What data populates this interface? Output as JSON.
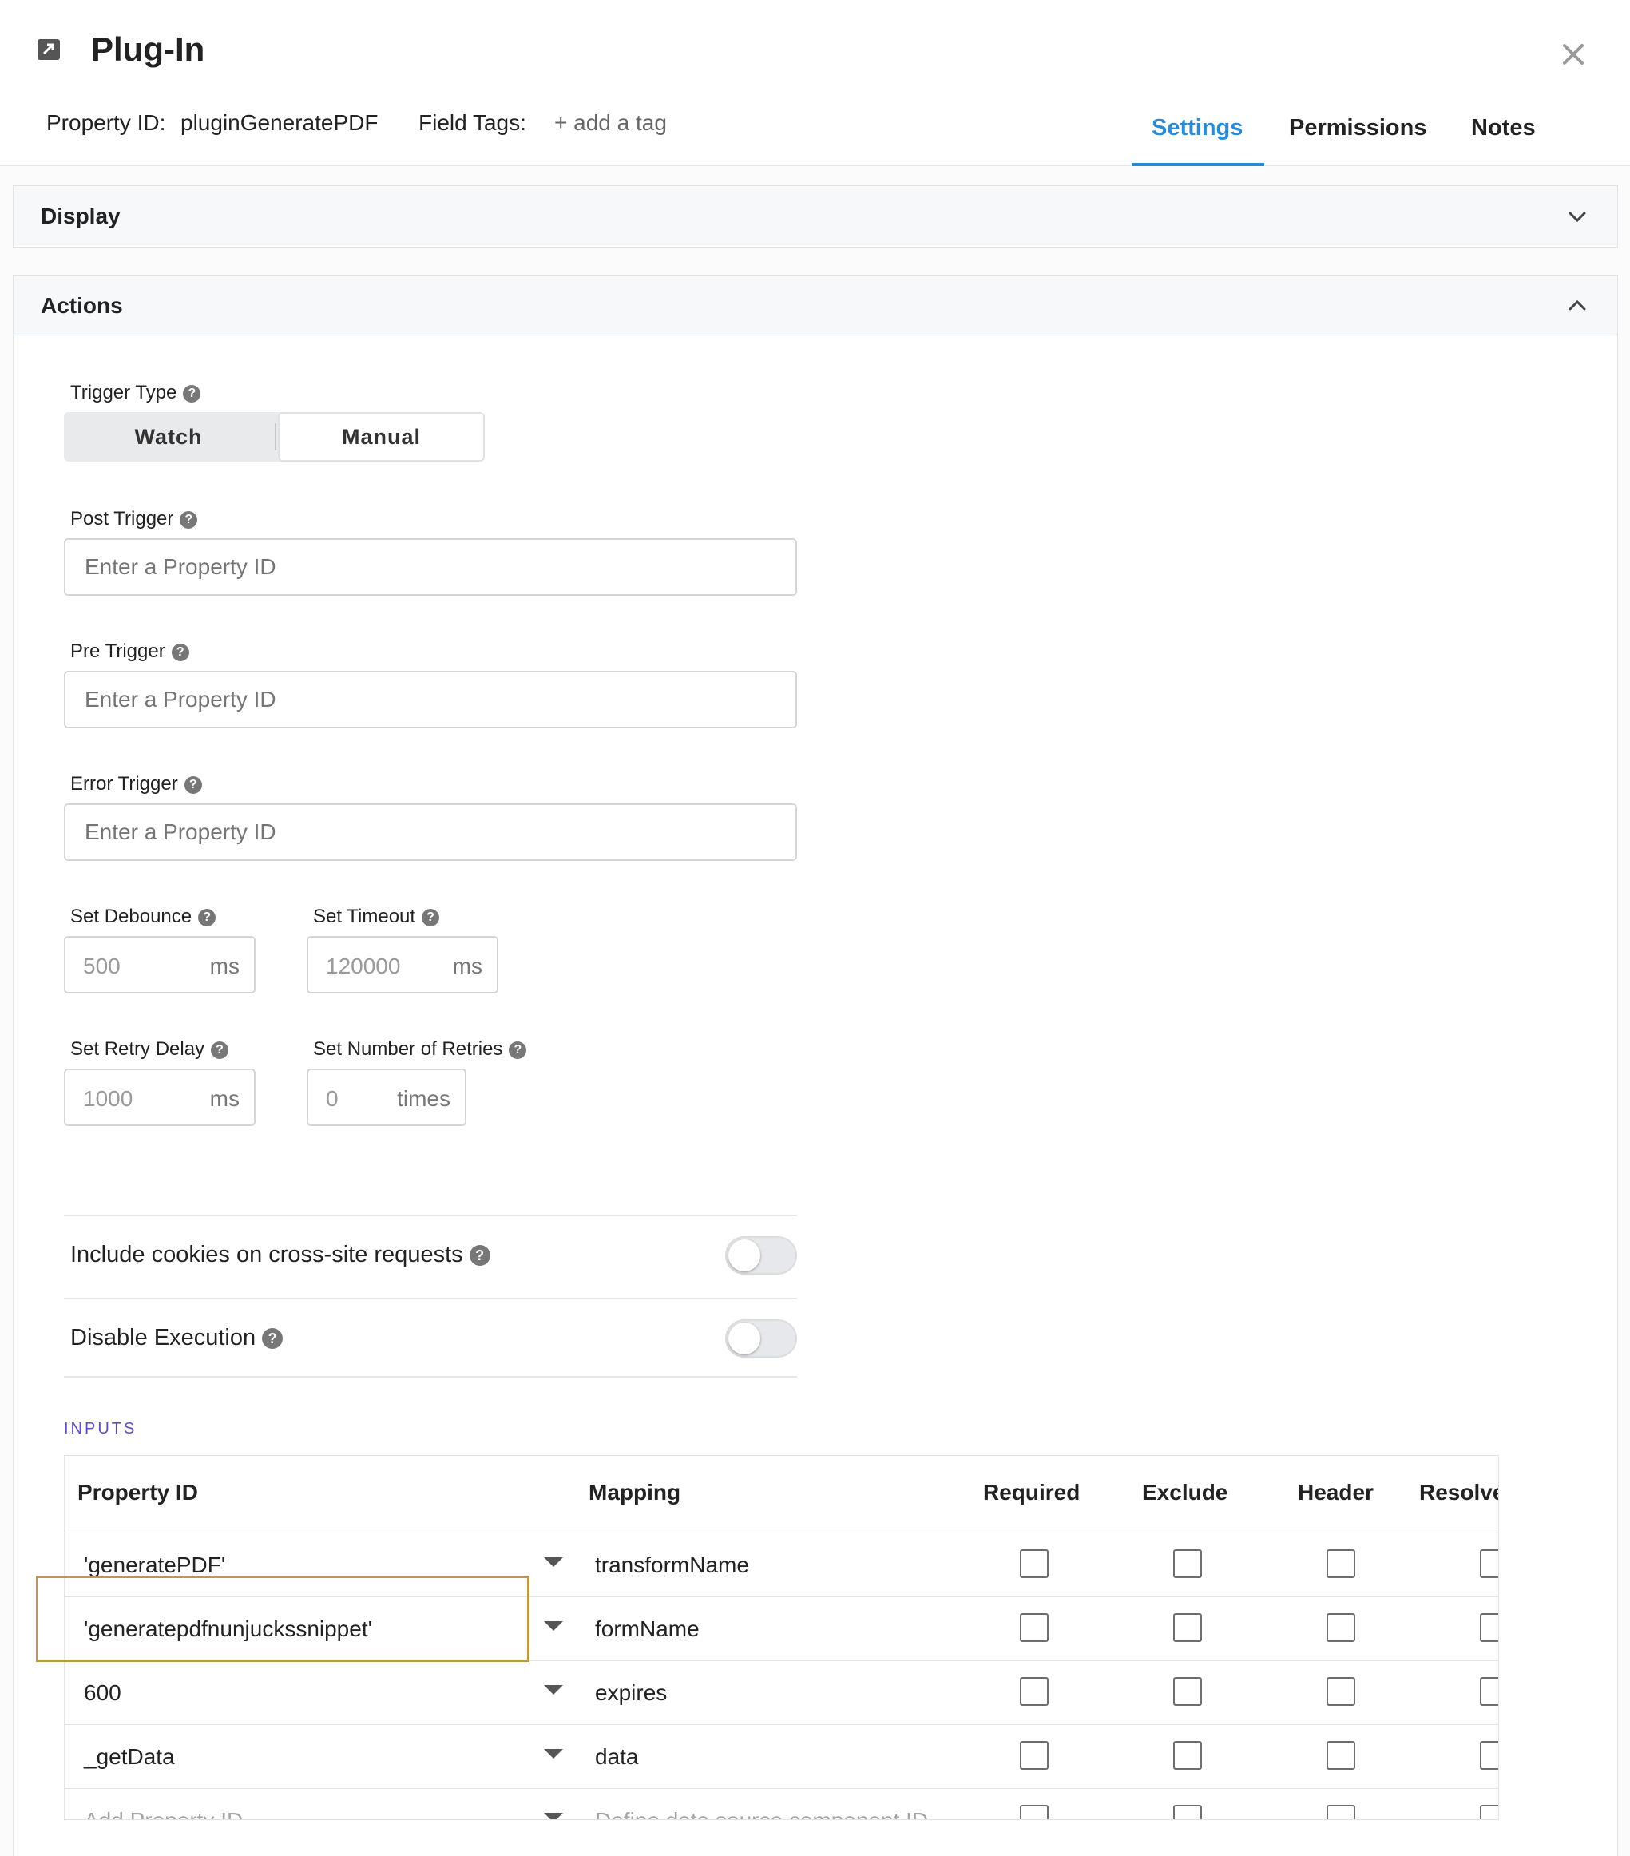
{
  "header": {
    "title": "Plug-In",
    "property_id_label": "Property ID:",
    "property_id_value": "pluginGeneratePDF",
    "field_tags_label": "Field Tags:",
    "add_tag": "+ add a tag",
    "tabs": [
      {
        "label": "Settings",
        "active": true
      },
      {
        "label": "Permissions",
        "active": false
      },
      {
        "label": "Notes",
        "active": false
      }
    ]
  },
  "display_panel": {
    "title": "Display",
    "expanded": false
  },
  "actions_panel": {
    "title": "Actions",
    "expanded": true,
    "trigger_type": {
      "label": "Trigger Type",
      "options": [
        "Watch",
        "Manual"
      ],
      "selected": "Manual"
    },
    "post_trigger": {
      "label": "Post Trigger",
      "placeholder": "Enter a Property ID",
      "value": ""
    },
    "pre_trigger": {
      "label": "Pre Trigger",
      "placeholder": "Enter a Property ID",
      "value": ""
    },
    "error_trigger": {
      "label": "Error Trigger",
      "placeholder": "Enter a Property ID",
      "value": ""
    },
    "debounce": {
      "label": "Set Debounce",
      "value": "500",
      "unit": "ms"
    },
    "timeout": {
      "label": "Set Timeout",
      "value": "120000",
      "unit": "ms"
    },
    "retry_delay": {
      "label": "Set Retry Delay",
      "value": "1000",
      "unit": "ms"
    },
    "retries": {
      "label": "Set Number of Retries",
      "value": "0",
      "unit": "times"
    },
    "include_cookies": {
      "label": "Include cookies on cross-site requests",
      "on": false
    },
    "disable_execution": {
      "label": "Disable Execution",
      "on": false
    }
  },
  "inputs": {
    "heading": "INPUTS",
    "columns": [
      "Property ID",
      "Mapping",
      "Required",
      "Exclude",
      "Header",
      "Resolve"
    ],
    "rows": [
      {
        "property_id": "'generatePDF'",
        "mapping": "transformName",
        "required": false,
        "exclude": false,
        "header": false,
        "resolve": false
      },
      {
        "property_id": "'generatepdfnunjuckssnippet'",
        "mapping": "formName",
        "required": false,
        "exclude": false,
        "header": false,
        "resolve": false
      },
      {
        "property_id": "600",
        "mapping": "expires",
        "required": false,
        "exclude": false,
        "header": false,
        "resolve": false
      },
      {
        "property_id": "_getData",
        "mapping": "data",
        "required": false,
        "exclude": false,
        "header": false,
        "resolve": false
      }
    ],
    "new_row": {
      "property_id_placeholder": "Add Property ID",
      "mapping_placeholder": "Define data source component ID"
    }
  },
  "colors": {
    "accent": "#2a8ad4",
    "inputs_heading": "#5a4fc4",
    "highlight": "#b79a4e"
  },
  "icons": [
    "external-link-icon",
    "close-icon",
    "chevron-down-icon",
    "chevron-up-icon",
    "help-icon",
    "dropdown-caret-icon"
  ]
}
